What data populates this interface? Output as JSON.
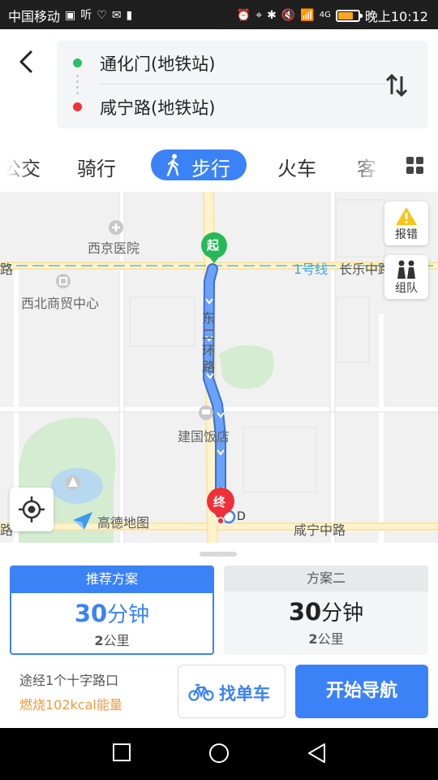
{
  "status_bar": {
    "carrier": "中国移动",
    "network_small": "4G",
    "time": "晚上10:12",
    "battery_level_percent": 75,
    "battery_color": "#f5a623"
  },
  "header": {
    "origin": "通化门(地铁站)",
    "destination": "咸宁路(地铁站)",
    "tabs": [
      "公交",
      "骑行",
      "步行",
      "火车",
      "客"
    ],
    "active_tab": "步行",
    "accent_color": "#3b82f6"
  },
  "map": {
    "labels": {
      "hospital": "西京医院",
      "trade_center": "西北商贸中心",
      "hotel": "建国饭店",
      "metro_line": "1号线",
      "road_changle": "长乐中路",
      "road_xianning": "咸宁中路",
      "road_east_ring": "东二环路",
      "start_marker": "起",
      "end_marker": "终",
      "metro_d": "D",
      "left_edge_road_1": "路",
      "left_edge_road_2": "路"
    },
    "buttons": {
      "report_error": "报错",
      "team": "组队"
    },
    "logo_text": "高德地图",
    "route_color": "#4a8bf5"
  },
  "panel": {
    "plans": [
      {
        "head": "推荐方案",
        "time_value": "30",
        "time_unit": "分钟",
        "dist_value": "2",
        "dist_unit": "公里"
      },
      {
        "head": "方案二",
        "time_value": "30",
        "time_unit": "分钟",
        "dist_value": "2",
        "dist_unit": "公里"
      }
    ],
    "info_line1": "途经1个十字路口",
    "info_line2": "燃烧102kcal能量",
    "bike_button": "找单车",
    "start_nav_button": "开始导航"
  },
  "icons": {
    "back": "back-arrow-icon",
    "swap": "swap-icon",
    "walk": "walking-icon",
    "grid": "grid-icon",
    "warning": "warning-icon",
    "team": "team-icon",
    "locate": "locate-icon",
    "bike": "bike-icon"
  }
}
